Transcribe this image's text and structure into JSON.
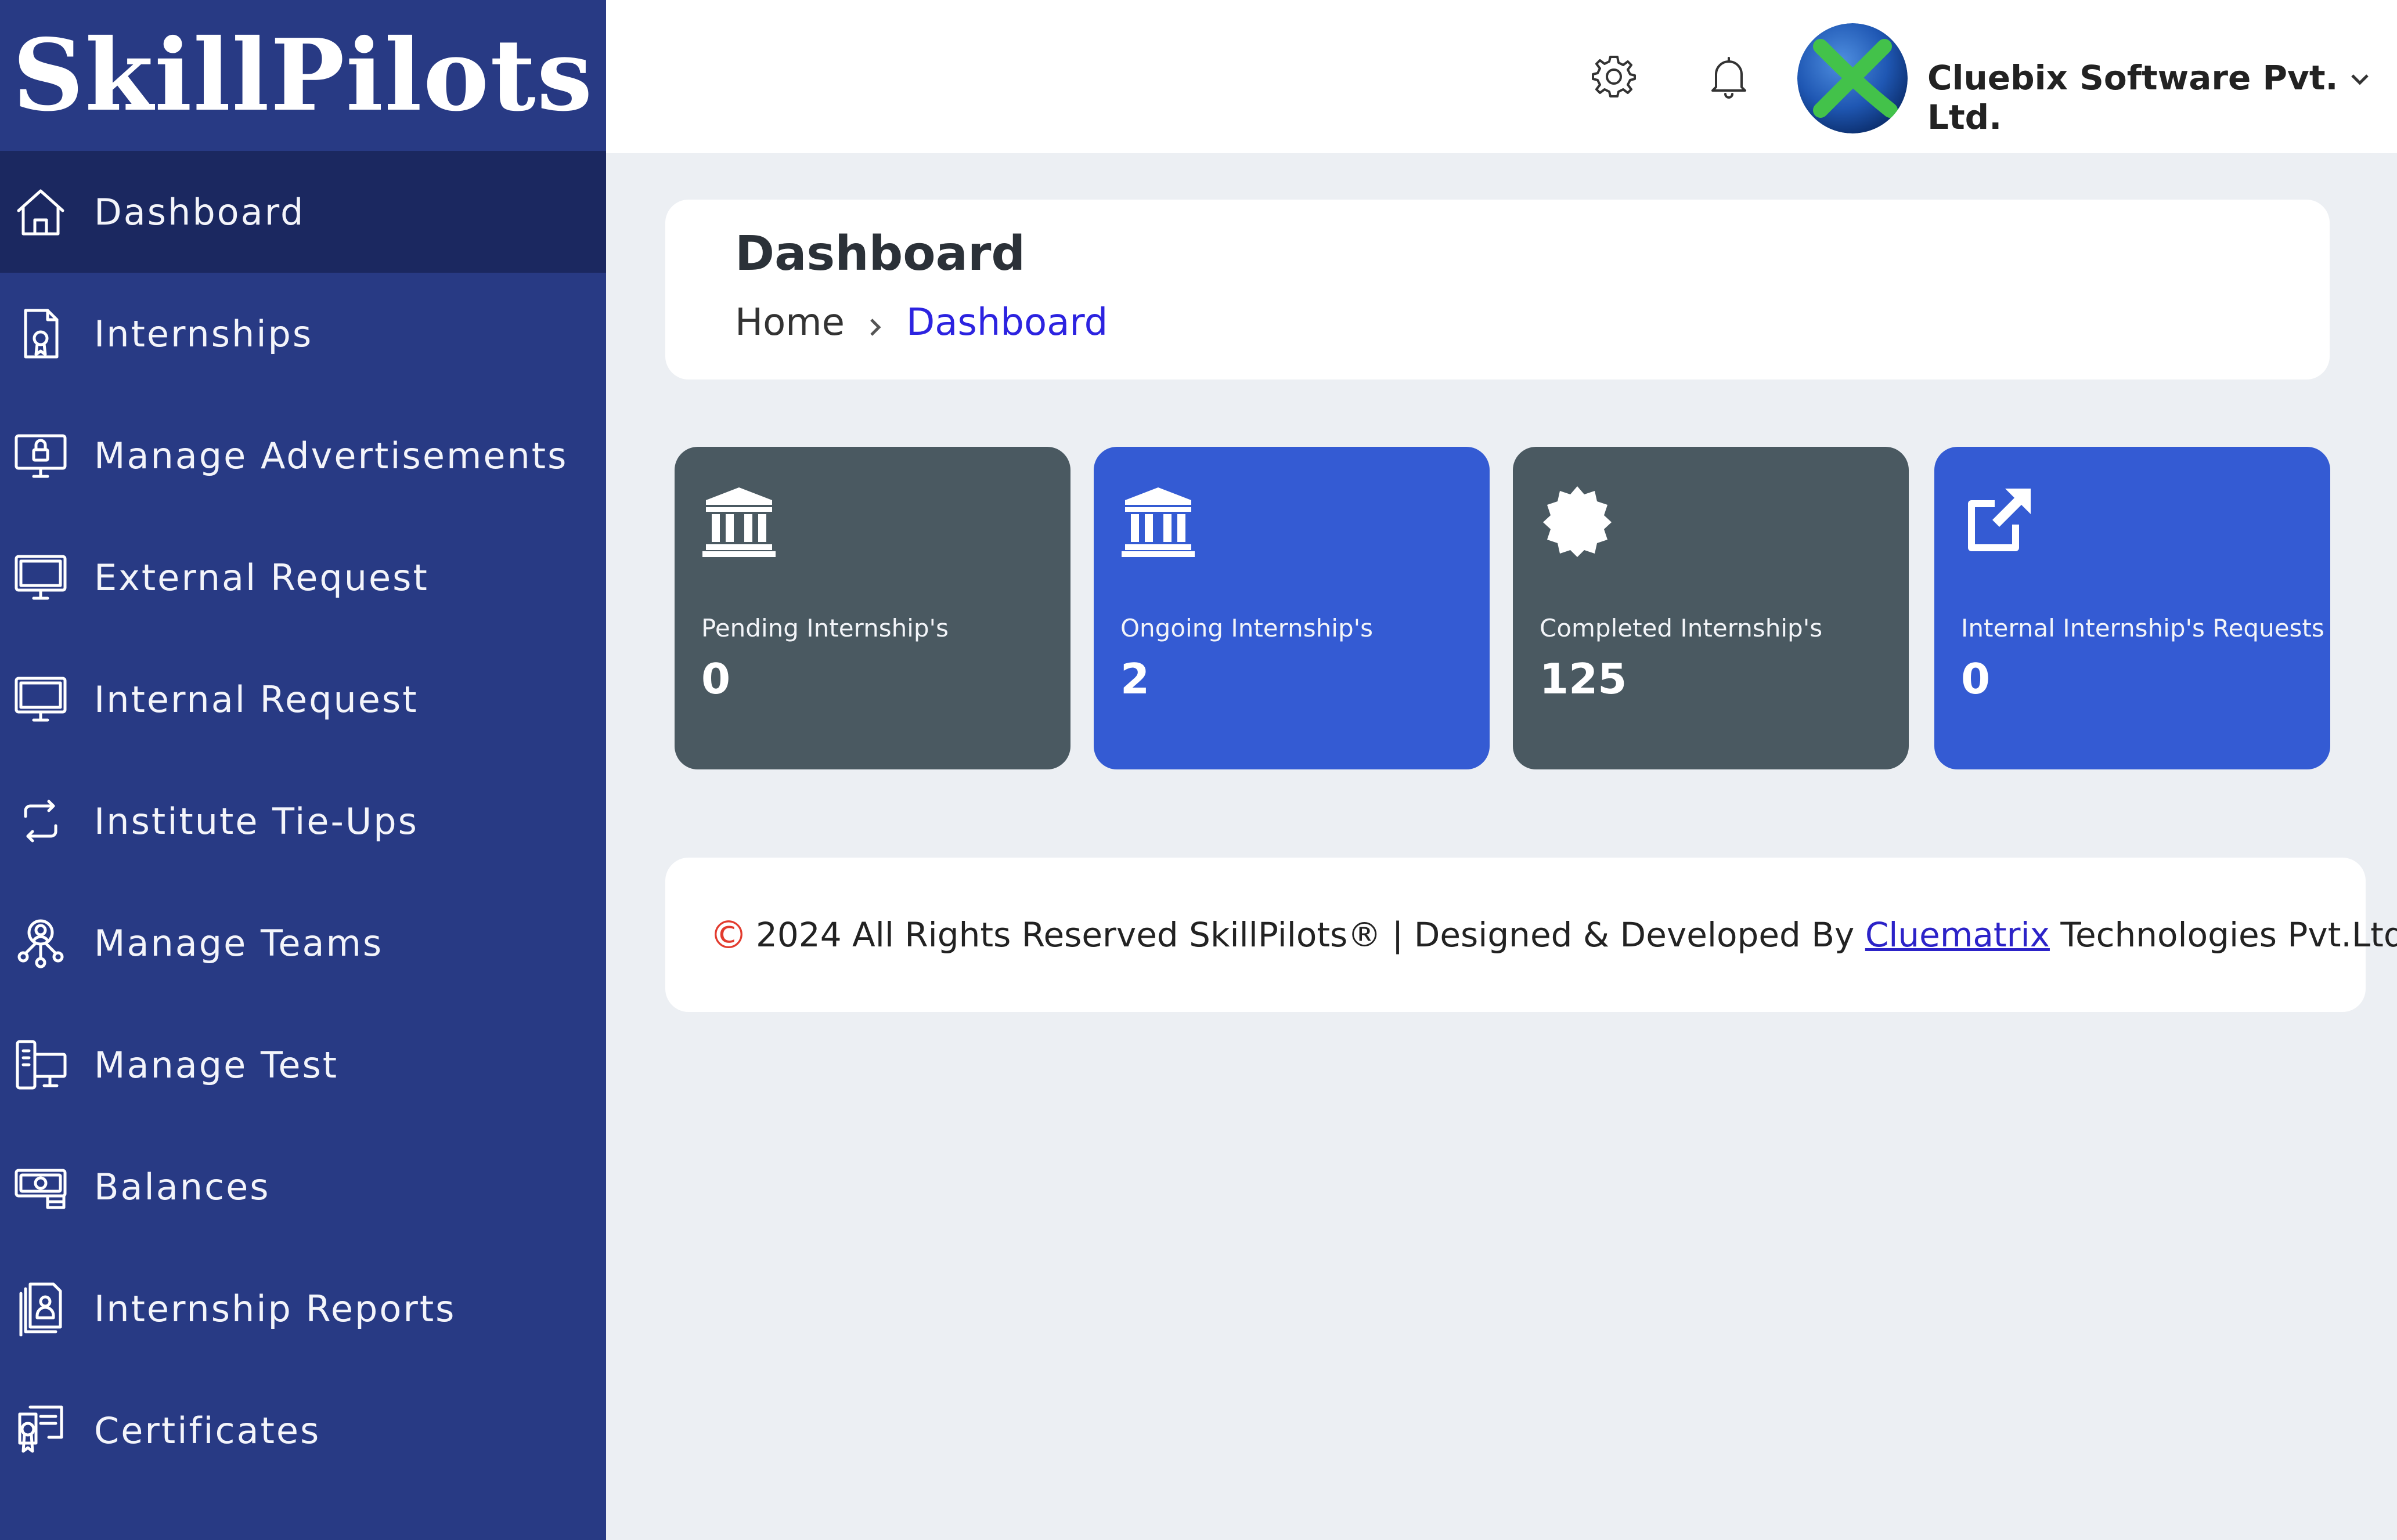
{
  "brand": {
    "name": "SkillPilots"
  },
  "sidebar": {
    "items": [
      {
        "label": "Dashboard",
        "icon": "home-icon",
        "active": true
      },
      {
        "label": "Internships",
        "icon": "certificate-doc-icon"
      },
      {
        "label": "Manage Advertisements",
        "icon": "monitor-lock-icon"
      },
      {
        "label": "External Request",
        "icon": "monitor-icon"
      },
      {
        "label": "Internal Request",
        "icon": "monitor-icon"
      },
      {
        "label": "Institute Tie-Ups",
        "icon": "refresh-icon"
      },
      {
        "label": "Manage Teams",
        "icon": "team-icon"
      },
      {
        "label": "Manage Test",
        "icon": "devices-icon"
      },
      {
        "label": "Balances",
        "icon": "money-icon"
      },
      {
        "label": "Internship Reports",
        "icon": "report-icon"
      },
      {
        "label": "Certificates",
        "icon": "certificate-icon"
      }
    ]
  },
  "header": {
    "settings_icon": "gear-icon",
    "notifications_icon": "bell-icon",
    "company_name": "Cluebix Software Pvt. Ltd."
  },
  "page": {
    "title": "Dashboard",
    "breadcrumb": {
      "home": "Home",
      "current": "Dashboard"
    }
  },
  "stats": [
    {
      "label": "Pending Internship's",
      "value": "0",
      "icon": "institution-icon",
      "color": "#4a5961"
    },
    {
      "label": "Ongoing Internship's",
      "value": "2",
      "icon": "institution-icon",
      "color": "#345bd3"
    },
    {
      "label": "Completed Internship's",
      "value": "125",
      "icon": "badge-icon",
      "color": "#4a5961"
    },
    {
      "label": "Internal Internship's Requests",
      "value": "0",
      "icon": "external-link-icon",
      "color": "#345bd3"
    }
  ],
  "footer": {
    "copyright_symbol": "©",
    "text_before": "2024 All Rights Reserved SkillPilots® | Designed & Developed By",
    "link_text": "Cluematrix",
    "text_after": "Technologies Pvt.Ltd."
  },
  "colors": {
    "sidebar": "#283a84",
    "sidebar_active": "#1b2860",
    "card_dark": "#4a5961",
    "card_blue": "#345bd3",
    "breadcrumb_active": "#2c23e0"
  }
}
